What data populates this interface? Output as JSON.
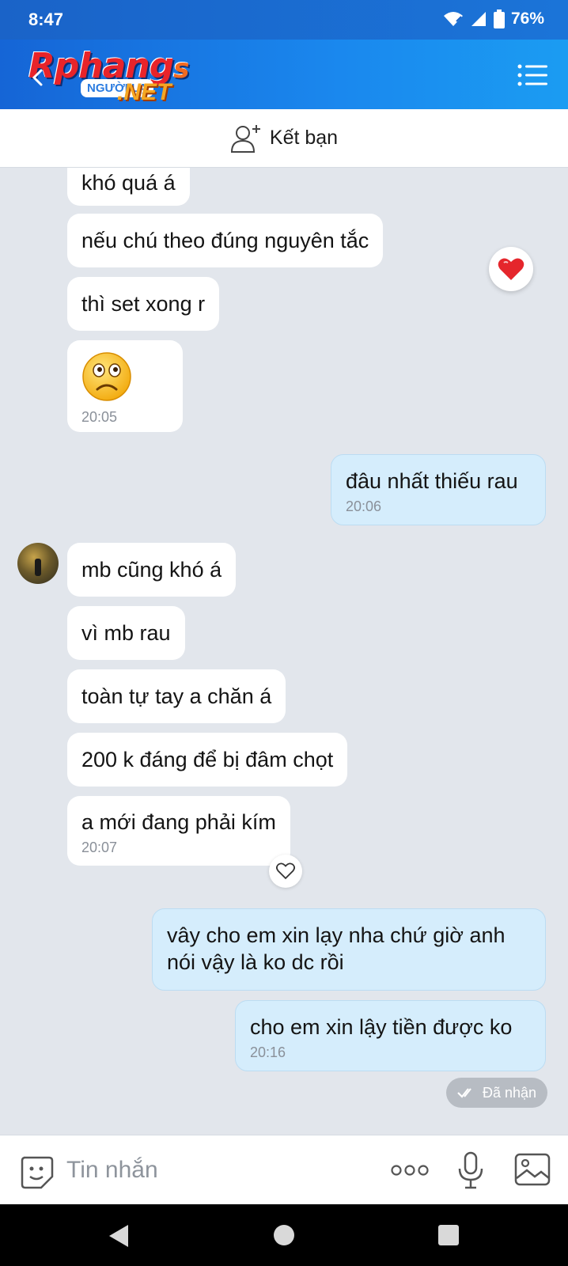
{
  "status_bar": {
    "time": "8:47",
    "battery": "76%"
  },
  "header": {
    "logo_main": "Rphang",
    "logo_last": "s",
    "logo_sub": "NGƯỜI LẠ",
    "logo_net": ".NET"
  },
  "friend_bar": {
    "label": "Kết bạn"
  },
  "messages": [
    {
      "text": "khó quá á"
    },
    {
      "text": "nếu chú theo đúng nguyên tắc"
    },
    {
      "text": "thì set xong r"
    },
    {
      "emoji": "sad-face",
      "time": "20:05"
    },
    {
      "text": "đâu nhất thiếu rau",
      "time": "20:06"
    },
    {
      "text": "mb cũng khó á"
    },
    {
      "text": "vì mb rau"
    },
    {
      "text": "toàn tự tay a chăn á"
    },
    {
      "text": "200 k đáng để bị đâm chọt"
    },
    {
      "text": "a mới đang phải kím",
      "time": "20:07"
    },
    {
      "text": "vây cho em xin lạy nha chứ giờ anh nói vậy là ko dc rồi"
    },
    {
      "text": "cho em xin lậy tiền được ko",
      "time": "20:16"
    }
  ],
  "received_badge": "Đã nhận",
  "input": {
    "placeholder": "Tin nhắn"
  },
  "colors": {
    "header_start": "#1565d6",
    "header_end": "#1b9cf2",
    "outgoing_bubble": "#d5edfc",
    "chat_bg": "#e2e6ec"
  }
}
